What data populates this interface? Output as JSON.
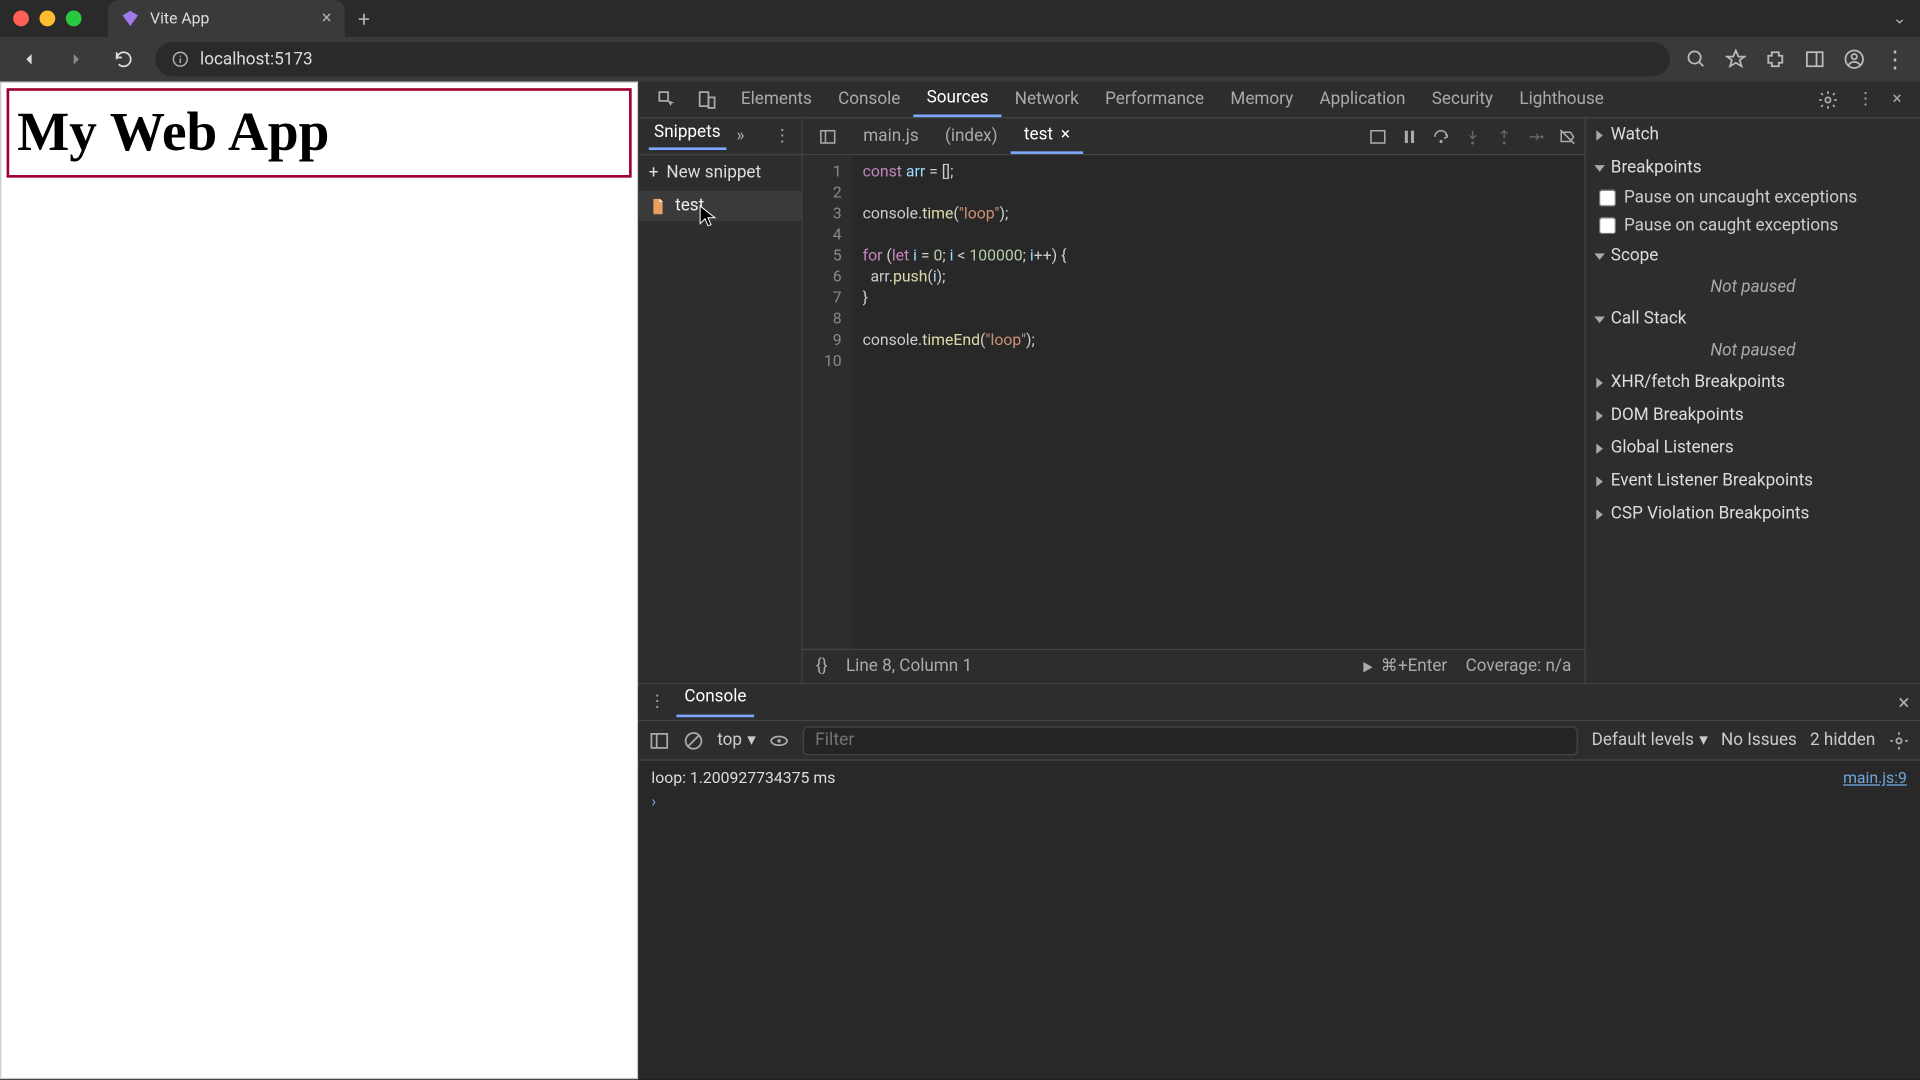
{
  "browser": {
    "tab_title": "Vite App",
    "url": "localhost:5173"
  },
  "page": {
    "heading": "My Web App"
  },
  "devtools": {
    "tabs": [
      "Elements",
      "Console",
      "Sources",
      "Network",
      "Performance",
      "Memory",
      "Application",
      "Security",
      "Lighthouse"
    ],
    "active_tab": "Sources"
  },
  "sources": {
    "left_panel_tab": "Snippets",
    "new_snippet_label": "New snippet",
    "snippets": [
      "test"
    ],
    "open_files": [
      "main.js",
      "(index)",
      "test"
    ],
    "active_file": "test",
    "code_lines": [
      {
        "n": "1",
        "html": "<span class='kw'>const</span> <span class='var'>arr</span> = [];"
      },
      {
        "n": "2",
        "html": ""
      },
      {
        "n": "3",
        "html": "console.<span class='fn'>time</span>(<span class='str'>\"loop\"</span>);"
      },
      {
        "n": "4",
        "html": ""
      },
      {
        "n": "5",
        "html": "<span class='kw'>for</span> (<span class='kw'>let</span> <span class='var'>i</span> = <span class='num'>0</span>; <span class='var'>i</span> &lt; <span class='num'>100000</span>; <span class='var'>i</span>++) {"
      },
      {
        "n": "6",
        "html": "  arr.<span class='fn'>push</span>(<span class='var'>i</span>);"
      },
      {
        "n": "7",
        "html": "}"
      },
      {
        "n": "8",
        "html": ""
      },
      {
        "n": "9",
        "html": "console.<span class='fn'>timeEnd</span>(<span class='str'>\"loop\"</span>);"
      },
      {
        "n": "10",
        "html": ""
      }
    ],
    "status_cursor": "Line 8, Column 1",
    "run_hint": "⌘+Enter",
    "coverage": "Coverage: n/a"
  },
  "debugger": {
    "sections": {
      "watch": "Watch",
      "breakpoints": "Breakpoints",
      "scope": "Scope",
      "call_stack": "Call Stack",
      "xhr": "XHR/fetch Breakpoints",
      "dom": "DOM Breakpoints",
      "global": "Global Listeners",
      "event": "Event Listener Breakpoints",
      "csp": "CSP Violation Breakpoints"
    },
    "pause_uncaught": "Pause on uncaught exceptions",
    "pause_caught": "Pause on caught exceptions",
    "not_paused": "Not paused"
  },
  "console": {
    "tab_label": "Console",
    "context": "top",
    "filter_placeholder": "Filter",
    "levels": "Default levels",
    "issues": "No Issues",
    "hidden": "2 hidden",
    "output_msg": "loop: 1.200927734375 ms",
    "output_src": "main.js:9"
  }
}
